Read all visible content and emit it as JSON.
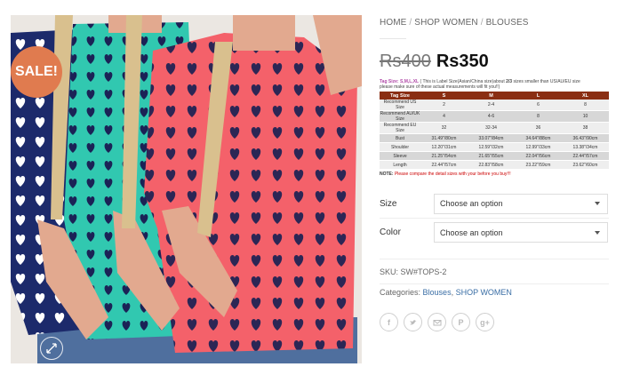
{
  "badge": {
    "sale": "SALE!"
  },
  "breadcrumb": {
    "items": [
      "HOME",
      "SHOP WOMEN",
      "BLOUSES"
    ],
    "separator": "/"
  },
  "price": {
    "old": "Rs400",
    "current": "Rs350"
  },
  "size_chart": {
    "note_label": "Tag Size:",
    "note_sizes": "S,M,L,XL",
    "note_text": "( This is Label Size(Asian/China size)about",
    "note_bold": "2/3",
    "note_text2": "sizes smaller than US/AU/EU size",
    "note_line2": "please make sure of these actual measurements will fit you!!)",
    "header": [
      "Tag Size",
      "S",
      "M",
      "L",
      "XL"
    ],
    "rows": [
      [
        "Recommend US Size",
        "2",
        "2-4",
        "6",
        "8"
      ],
      [
        "Recommend AU/UK Size",
        "4",
        "4-6",
        "8",
        "10"
      ],
      [
        "Recommend EU Size",
        "32",
        "32-34",
        "36",
        "38"
      ],
      [
        "Bust",
        "31.49\"/80cm",
        "33.07\"/84cm",
        "34.64\"/88cm",
        "36.43\"/90cm"
      ],
      [
        "Shoulder",
        "12.20\"/31cm",
        "12.59\"/32cm",
        "12.99\"/33cm",
        "13.38\"/34cm"
      ],
      [
        "Sleeve",
        "21.25\"/54cm",
        "21.65\"/55cm",
        "22.04\"/56cm",
        "22.44\"/57cm"
      ],
      [
        "Length",
        "22.44\"/57cm",
        "22.83\"/58cm",
        "23.22\"/59cm",
        "23.62\"/60cm"
      ]
    ],
    "footer_label": "NOTE:",
    "footer_text": "Please compare the detail sizes with your before you buy!!!"
  },
  "variations": [
    {
      "label": "Size",
      "placeholder": "Choose an option"
    },
    {
      "label": "Color",
      "placeholder": "Choose an option"
    }
  ],
  "meta": {
    "sku_label": "SKU:",
    "sku": "SW#TOPS-2",
    "categories_label": "Categories:",
    "categories": [
      "Blouses",
      "SHOP WOMEN"
    ]
  },
  "share_icons": [
    "facebook-icon",
    "twitter-icon",
    "email-icon",
    "pinterest-icon",
    "google-plus-icon"
  ],
  "colors": {
    "sale_badge": "#e07b4f",
    "table_header": "#8a2e12",
    "link": "#3a6ea5"
  }
}
